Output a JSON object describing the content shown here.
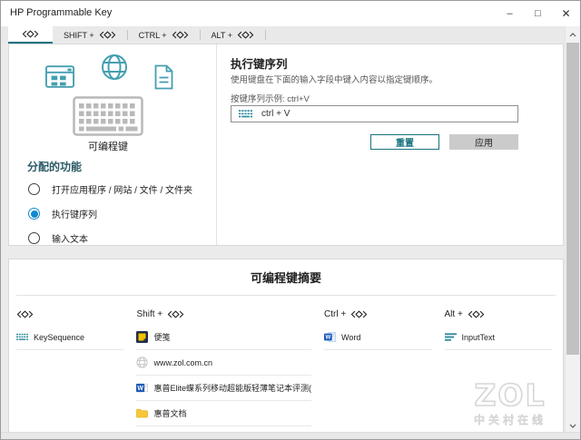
{
  "window": {
    "title": "HP Programmable Key",
    "controls": {
      "minimize": "–",
      "maximize": "□",
      "close": "✕"
    }
  },
  "tabs": [
    {
      "label": "",
      "selected": true
    },
    {
      "label": "SHIFT +",
      "selected": false
    },
    {
      "label": "CTRL +",
      "selected": false
    },
    {
      "label": "ALT +",
      "selected": false
    }
  ],
  "left_panel": {
    "key_label": "可编程键",
    "heading": "分配的功能",
    "options": [
      {
        "label": "打开应用程序 / 网站 / 文件 / 文件夹",
        "selected": false
      },
      {
        "label": "执行键序列",
        "selected": true
      },
      {
        "label": "输入文本",
        "selected": false
      }
    ]
  },
  "right_panel": {
    "heading": "执行键序列",
    "description": "使用键盘在下面的输入字段中键入内容以指定键顺序。",
    "example_label": "按键序列示例: ctrl+V",
    "input_value": "ctrl + V",
    "reset_label": "重置",
    "apply_label": "应用"
  },
  "summary": {
    "heading": "可编程键摘要",
    "columns": [
      {
        "modifier": "",
        "items": [
          {
            "icon": "keyboard-small",
            "label": "KeySequence"
          }
        ]
      },
      {
        "modifier": "Shift +",
        "items": [
          {
            "icon": "sticky-notes",
            "label": "便笺"
          },
          {
            "icon": "globe-gray",
            "label": "www.zol.com.cn"
          },
          {
            "icon": "word-doc-file",
            "label": "惠普Elite蝶系列移动超能版轻薄笔记本评测("
          },
          {
            "icon": "folder",
            "label": "惠普文档"
          }
        ]
      },
      {
        "modifier": "Ctrl +",
        "items": [
          {
            "icon": "word-app",
            "label": "Word"
          }
        ]
      },
      {
        "modifier": "Alt +",
        "items": [
          {
            "icon": "text-lines",
            "label": "InputText"
          }
        ]
      }
    ]
  },
  "watermark": {
    "brand": "ZOL",
    "site": "中关村在线"
  },
  "colors": {
    "accent_teal": "#17727f",
    "icon_teal": "#459fb0",
    "radio_selected": "#1389cd",
    "sticky_note_yellow": "#f6c500",
    "word_blue": "#185abd",
    "folder_yellow": "#f9c636"
  }
}
